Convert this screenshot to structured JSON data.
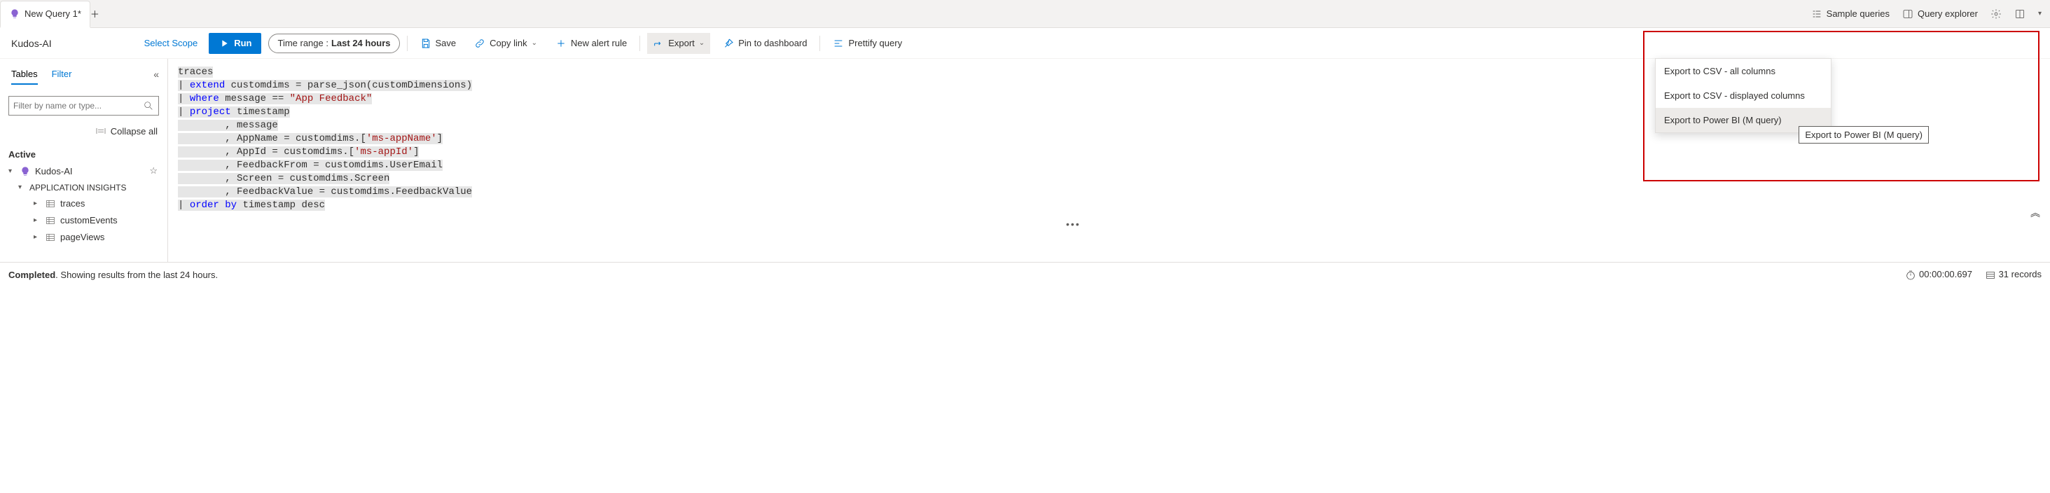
{
  "tabs": {
    "active": "New Query 1*"
  },
  "top_tools": {
    "sample_queries": "Sample queries",
    "query_explorer": "Query explorer"
  },
  "scope": {
    "name": "Kudos-AI",
    "select_scope": "Select Scope"
  },
  "run": {
    "label": "Run"
  },
  "time_range": {
    "prefix": "Time range : ",
    "value": "Last 24 hours"
  },
  "toolbar": {
    "save": "Save",
    "copylink": "Copy link",
    "newalert": "New alert rule",
    "export": "Export",
    "pin": "Pin to dashboard",
    "prettify": "Prettify query"
  },
  "sidebar": {
    "tabs": {
      "tables": "Tables",
      "filter": "Filter"
    },
    "filter_placeholder": "Filter by name or type...",
    "collapse_all": "Collapse all",
    "active": "Active",
    "root": "Kudos-AI",
    "group": "APPLICATION INSIGHTS",
    "items": [
      "traces",
      "customEvents",
      "pageViews"
    ]
  },
  "query_lines": [
    "traces",
    "| extend customdims = parse_json(customDimensions)",
    "| where message == \"App Feedback\"",
    "| project timestamp",
    "        , message",
    "        , AppName = customdims.['ms-appName']",
    "        , AppId = customdims.['ms-appId']",
    "        , FeedbackFrom = customdims.UserEmail",
    "        , Screen = customdims.Screen",
    "        , FeedbackValue = customdims.FeedbackValue",
    "| order by timestamp desc"
  ],
  "export_menu": [
    "Export to CSV - all columns",
    "Export to CSV - displayed columns",
    "Export to Power BI (M query)"
  ],
  "tooltip": "Export to Power BI (M query)",
  "status": {
    "completed": "Completed",
    "detail": ". Showing results from the last 24 hours.",
    "time": "00:00:00.697",
    "records": "31 records"
  }
}
